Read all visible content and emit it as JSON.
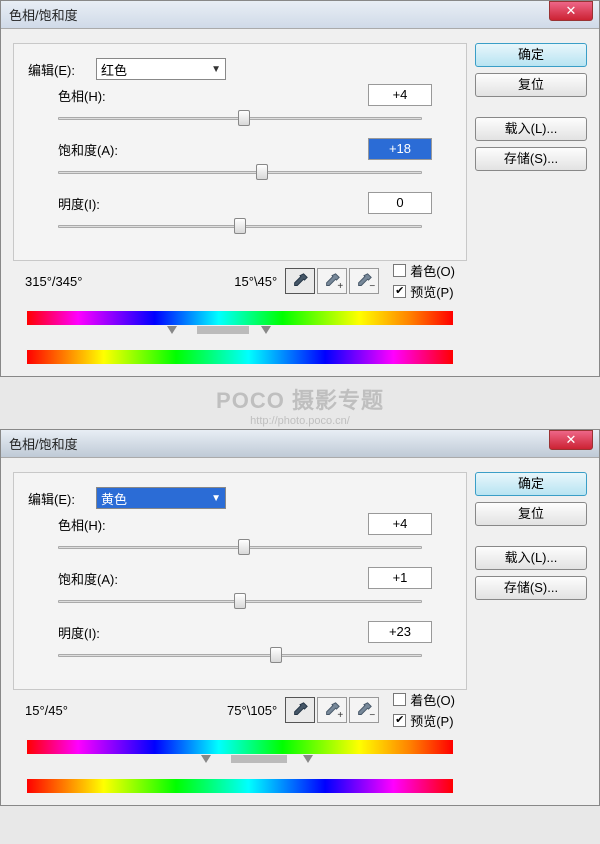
{
  "dialog1": {
    "title": "色相/饱和度",
    "edit_label": "编辑(E):",
    "edit_value": "红色",
    "hue_label": "色相(H):",
    "hue_value": "+4",
    "sat_label": "饱和度(A):",
    "sat_value": "+18",
    "light_label": "明度(I):",
    "light_value": "0",
    "degrees_left": "315°/345°",
    "degrees_right": "15°\\45°",
    "colorize_label": "着色(O)",
    "preview_label": "预览(P)",
    "buttons": {
      "ok": "确定",
      "reset": "复位",
      "load": "载入(L)...",
      "save": "存储(S)..."
    }
  },
  "dialog2": {
    "title": "色相/饱和度",
    "edit_label": "编辑(E):",
    "edit_value": "黄色",
    "hue_label": "色相(H):",
    "hue_value": "+4",
    "sat_label": "饱和度(A):",
    "sat_value": "+1",
    "light_label": "明度(I):",
    "light_value": "+23",
    "degrees_left": "15°/45°",
    "degrees_right": "75°\\105°",
    "colorize_label": "着色(O)",
    "preview_label": "预览(P)",
    "buttons": {
      "ok": "确定",
      "reset": "复位",
      "load": "载入(L)...",
      "save": "存储(S)..."
    }
  },
  "watermark": {
    "line1": "POCO 摄影专题",
    "line2": "http://photo.poco.cn/"
  }
}
